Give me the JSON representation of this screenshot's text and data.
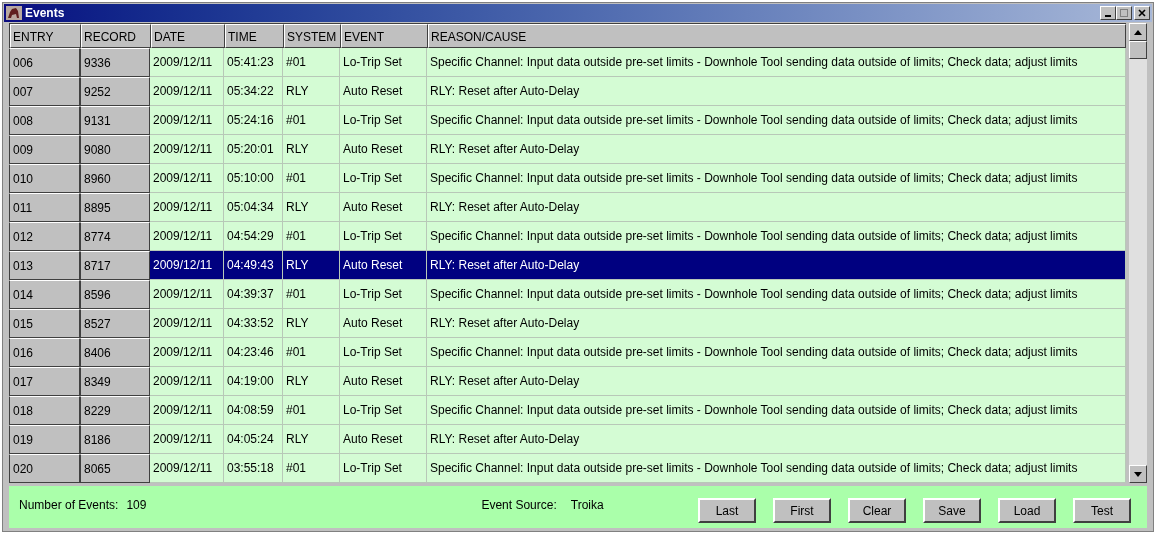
{
  "window": {
    "title": "Events"
  },
  "table": {
    "columns": [
      "ENTRY",
      "RECORD",
      "DATE",
      "TIME",
      "SYSTEM",
      "EVENT",
      "REASON/CAUSE"
    ],
    "rows": [
      {
        "entry": "006",
        "record": "9336",
        "date": "2009/12/11",
        "time": "05:41:23",
        "system": "#01",
        "event": "Lo-Trip  Set",
        "reason": "Specific Channel: Input data outside pre-set limits - Downhole Tool sending data outside of limits; Check data; adjust limits",
        "selected": false
      },
      {
        "entry": "007",
        "record": "9252",
        "date": "2009/12/11",
        "time": "05:34:22",
        "system": "RLY",
        "event": "Auto Reset",
        "reason": "RLY: Reset after Auto-Delay",
        "selected": false
      },
      {
        "entry": "008",
        "record": "9131",
        "date": "2009/12/11",
        "time": "05:24:16",
        "system": "#01",
        "event": "Lo-Trip  Set",
        "reason": "Specific Channel: Input data outside pre-set limits - Downhole Tool sending data outside of limits; Check data; adjust limits",
        "selected": false
      },
      {
        "entry": "009",
        "record": "9080",
        "date": "2009/12/11",
        "time": "05:20:01",
        "system": "RLY",
        "event": "Auto Reset",
        "reason": "RLY: Reset after Auto-Delay",
        "selected": false
      },
      {
        "entry": "010",
        "record": "8960",
        "date": "2009/12/11",
        "time": "05:10:00",
        "system": "#01",
        "event": "Lo-Trip  Set",
        "reason": "Specific Channel: Input data outside pre-set limits - Downhole Tool sending data outside of limits; Check data; adjust limits",
        "selected": false
      },
      {
        "entry": "011",
        "record": "8895",
        "date": "2009/12/11",
        "time": "05:04:34",
        "system": "RLY",
        "event": "Auto Reset",
        "reason": "RLY: Reset after Auto-Delay",
        "selected": false
      },
      {
        "entry": "012",
        "record": "8774",
        "date": "2009/12/11",
        "time": "04:54:29",
        "system": "#01",
        "event": "Lo-Trip  Set",
        "reason": "Specific Channel: Input data outside pre-set limits - Downhole Tool sending data outside of limits; Check data; adjust limits",
        "selected": false
      },
      {
        "entry": "013",
        "record": "8717",
        "date": "2009/12/11",
        "time": "04:49:43",
        "system": "RLY",
        "event": "Auto Reset",
        "reason": "RLY: Reset after Auto-Delay",
        "selected": true
      },
      {
        "entry": "014",
        "record": "8596",
        "date": "2009/12/11",
        "time": "04:39:37",
        "system": "#01",
        "event": "Lo-Trip  Set",
        "reason": "Specific Channel: Input data outside pre-set limits - Downhole Tool sending data outside of limits; Check data; adjust limits",
        "selected": false
      },
      {
        "entry": "015",
        "record": "8527",
        "date": "2009/12/11",
        "time": "04:33:52",
        "system": "RLY",
        "event": "Auto Reset",
        "reason": "RLY: Reset after Auto-Delay",
        "selected": false
      },
      {
        "entry": "016",
        "record": "8406",
        "date": "2009/12/11",
        "time": "04:23:46",
        "system": "#01",
        "event": "Lo-Trip  Set",
        "reason": "Specific Channel: Input data outside pre-set limits - Downhole Tool sending data outside of limits; Check data; adjust limits",
        "selected": false
      },
      {
        "entry": "017",
        "record": "8349",
        "date": "2009/12/11",
        "time": "04:19:00",
        "system": "RLY",
        "event": "Auto Reset",
        "reason": "RLY: Reset after Auto-Delay",
        "selected": false
      },
      {
        "entry": "018",
        "record": "8229",
        "date": "2009/12/11",
        "time": "04:08:59",
        "system": "#01",
        "event": "Lo-Trip  Set",
        "reason": "Specific Channel: Input data outside pre-set limits - Downhole Tool sending data outside of limits; Check data; adjust limits",
        "selected": false
      },
      {
        "entry": "019",
        "record": "8186",
        "date": "2009/12/11",
        "time": "04:05:24",
        "system": "RLY",
        "event": "Auto Reset",
        "reason": "RLY: Reset after Auto-Delay",
        "selected": false
      },
      {
        "entry": "020",
        "record": "8065",
        "date": "2009/12/11",
        "time": "03:55:18",
        "system": "#01",
        "event": "Lo-Trip  Set",
        "reason": "Specific Channel: Input data outside pre-set limits - Downhole Tool sending data outside of limits; Check data; adjust limits",
        "selected": false
      }
    ]
  },
  "footer": {
    "count_label": "Number of Events:",
    "count": "109",
    "source_label": "Event Source:",
    "source": "Troika",
    "buttons": [
      "Last",
      "First",
      "Clear",
      "Save",
      "Load",
      "Test"
    ]
  }
}
